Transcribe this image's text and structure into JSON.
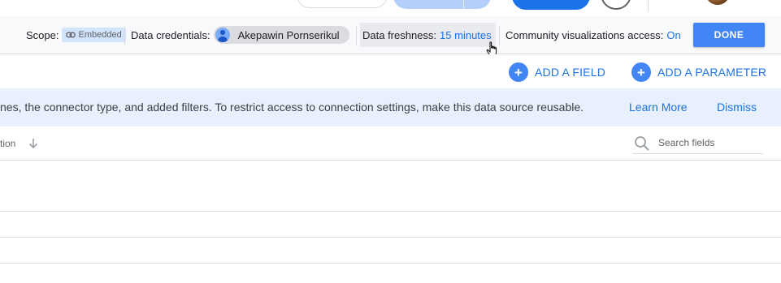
{
  "settings": {
    "scope_label": "Scope:",
    "scope_value": "Embedded",
    "credentials_label": "Data credentials:",
    "credentials_user": "Akepawin Pornserikul",
    "freshness_label": "Data freshness:",
    "freshness_value": "15 minutes",
    "community_label": "Community visualizations access:",
    "community_value": "On",
    "done_label": "DONE"
  },
  "actions": {
    "add_field": "ADD A FIELD",
    "add_parameter": "ADD A PARAMETER"
  },
  "banner": {
    "text": "nes, the connector type, and added filters. To restrict access to connection settings, make this data source reusable.",
    "learn_more": "Learn More",
    "dismiss": "Dismiss"
  },
  "table": {
    "column_label": "tion",
    "search_placeholder": "Search fields"
  },
  "colors": {
    "accent": "#1a73e8",
    "button_blue": "#4285f4",
    "banner_bg": "#e8f0fe",
    "settings_bg": "#f8f9fa"
  }
}
